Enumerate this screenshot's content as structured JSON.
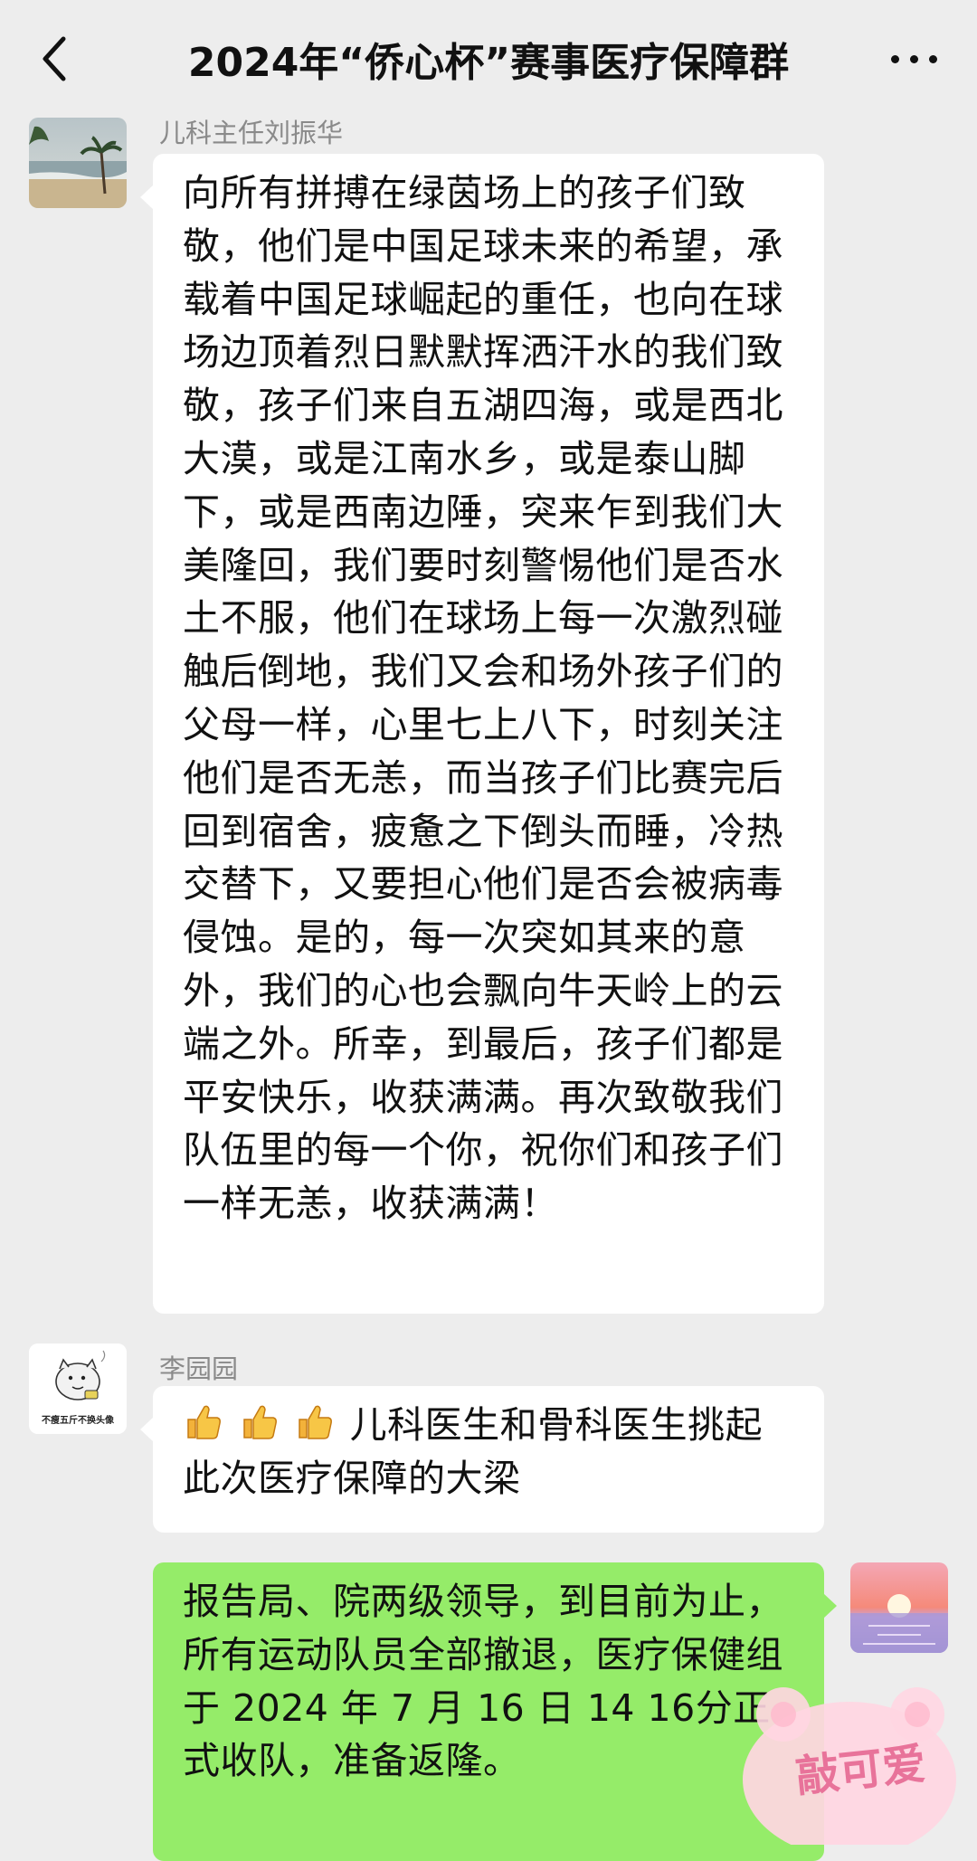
{
  "header": {
    "title": "2024年“侨心杯”赛事医疗保障群",
    "back_icon": "chevron-left-icon",
    "more_icon": "more-dots-icon"
  },
  "messages": [
    {
      "sender": "儿科主任刘振华",
      "text": "向所有拼搏在绿茵场上的孩子们致敬，他们是中国足球未来的希望，承载着中国足球崛起的重任，也向在球场边顶着烈日默默挥洒汗水的我们致敬，孩子们来自五湖四海，或是西北大漠，或是江南水乡，或是泰山脚下，或是西南边陲，突来乍到我们大美隆回，我们要时刻警惕他们是否水土不服，他们在球场上每一次激烈碰触后倒地，我们又会和场外孩子们的父母一样，心里七上八下，时刻关注他们是否无恙，而当孩子们比赛完后回到宿舍，疲惫之下倒头而睡，冷热交替下，又要担心他们是否会被病毒侵蚀。是的，每一次突如其来的意外，我们的心也会飘向牛天岭上的云端之外。所幸，到最后，孩子们都是平安快乐，收获满满。再次致敬我们队伍里的每一个你，祝你们和孩子们一样无恙，收获满满！"
    },
    {
      "sender": "李园园",
      "avatar_caption": "不瘦五斤不换头像",
      "text": "儿科医生和骨科医生挑起此次医疗保障的大梁",
      "emoji": "thumbs-up-icon"
    },
    {
      "text": "报告局、院两级领导，到目前为止，所有运动队员全部撤退，医疗保健组于 2024 年 7 月 16 日 14 16分正式收队，准备返隆。"
    }
  ],
  "watermark": {
    "text": "敲可爱"
  },
  "colors": {
    "background": "#ededed",
    "bubble_self": "#95ec69",
    "bubble_other": "#ffffff"
  }
}
